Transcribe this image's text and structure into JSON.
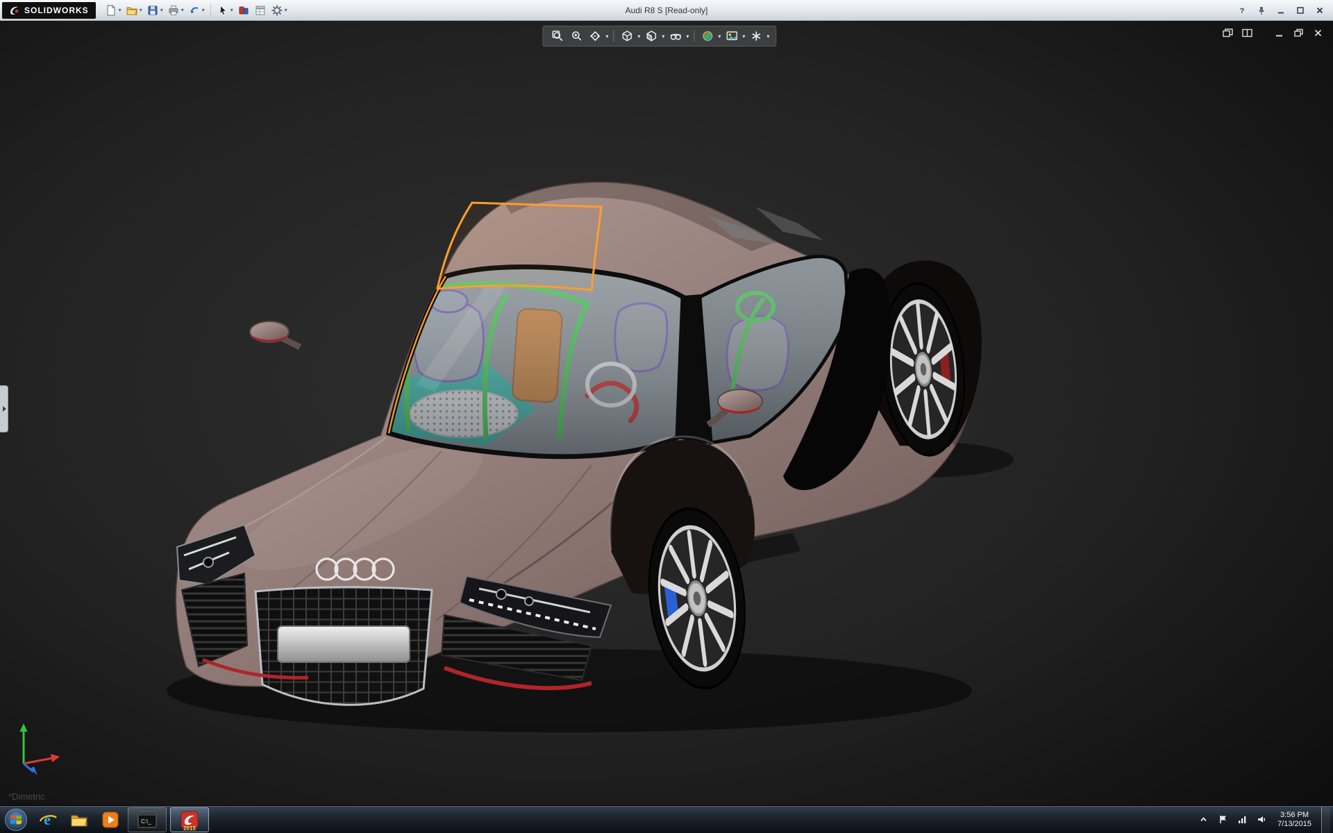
{
  "window": {
    "app_name": "SOLIDWORKS",
    "title": "Audi R8 S [Read-only]",
    "controls": [
      "help",
      "pin",
      "minimize",
      "maximize",
      "close"
    ]
  },
  "main_toolbar": {
    "icons": [
      "new-document",
      "open",
      "save",
      "print",
      "undo",
      "select",
      "macro",
      "file-properties",
      "options"
    ]
  },
  "heads_up_toolbar": {
    "icons": [
      "zoom-fit",
      "zoom-area",
      "section-view",
      "view-orientation",
      "display-style",
      "hide-show-items",
      "edit-appearance",
      "apply-scene",
      "view-settings"
    ]
  },
  "document_window": {
    "controls": [
      "new-window",
      "split-window",
      "minimize",
      "restore",
      "close"
    ]
  },
  "viewport": {
    "view_label": "*Dimetric",
    "background_color": "#1b1b1b",
    "model": {
      "name": "Audi R8 S",
      "body_color": "#99827e",
      "selection_color": "#ff9d2e",
      "interior": {
        "cage_color": "#4ec653",
        "seat_color": "#9aa0a6",
        "seat_piping_color": "#7a5fae",
        "center_panel_color": "#c8813f",
        "floor_color": "#3fb3a5",
        "hose_color": "#cf3030"
      },
      "wheel_rim_color": "#d9d9d9",
      "caliper_color": "#2a60d4"
    }
  },
  "taskbar": {
    "items": [
      "start",
      "internet-explorer",
      "file-explorer",
      "media-player",
      "command-prompt",
      "solidworks"
    ],
    "console_glyph": "C:\\_",
    "solidworks_badge": "2015",
    "tray": {
      "icons": [
        "hidden-icons",
        "action-center",
        "network",
        "volume"
      ],
      "time": "3:56 PM",
      "date": "7/13/2015"
    }
  }
}
